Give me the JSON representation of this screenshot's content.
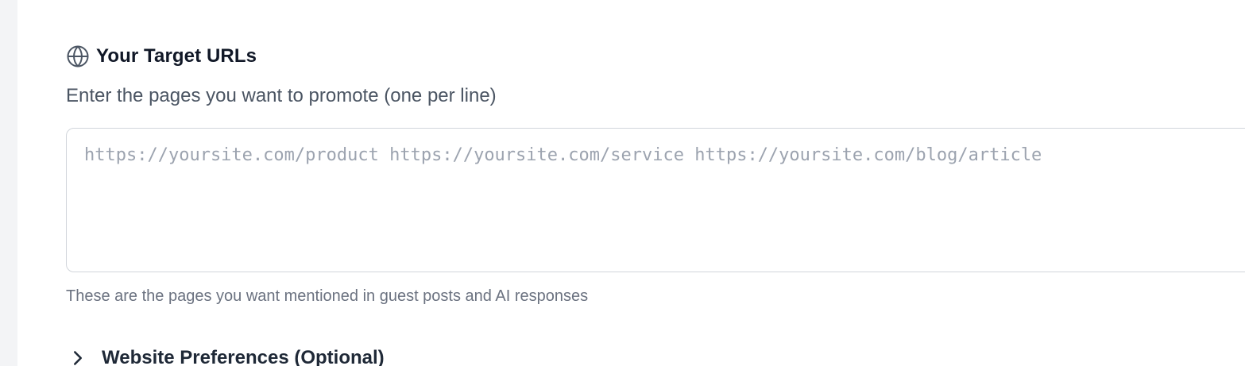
{
  "target_urls": {
    "icon": "globe-icon",
    "title": "Your Target URLs",
    "description": "Enter the pages you want to promote (one per line)",
    "placeholder": "https://yoursite.com/product https://yoursite.com/service https://yoursite.com/blog/article",
    "value": "",
    "helper_text": "These are the pages you want mentioned in guest posts and AI responses"
  },
  "website_preferences": {
    "icon": "chevron-right-icon",
    "label": "Website Preferences (Optional)"
  }
}
